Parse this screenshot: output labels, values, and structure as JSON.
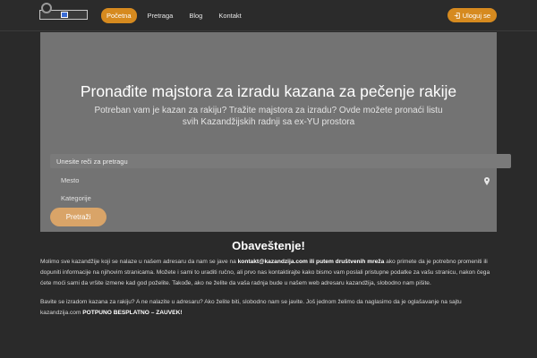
{
  "header": {
    "nav": [
      "Početna",
      "Pretraga",
      "Blog",
      "Kontakt"
    ],
    "active_index": 0,
    "login_label": "Uloguj se",
    "accent_color": "#d68a1f"
  },
  "hero": {
    "title": "Pronađite majstora za izradu kazana za pečenje rakije",
    "subtitle": "Potreban vam je kazan za rakiju? Tražite majstora za izradu? Ovde možete pronaći listu svih Kazandžijskih radnji sa ex-YU prostora",
    "search_placeholder": "Unesite reči za pretragu",
    "place_placeholder": "Mesto",
    "category_placeholder": "Kategorije",
    "search_button": "Pretraži"
  },
  "notice": {
    "title": "Obaveštenje!",
    "p1_a": "Molimo sve kazandžije koji se nalaze u našem adresaru da nam se jave na ",
    "p1_b": "kontakt@kazandzija.com ili putem društvenih mreža",
    "p1_c": " ako primete da je potrebno promeniti ili dopuniti informacije na njihovim stranicama. Možete i sami to uraditi ručno, ali prvo nas kontaktirajte kako bismo vam poslali pristupne podatke za vašu stranicu, nakon čega ćete moći sami da vršite izmene kad god poželite. Takođe, ako ne želite da vaša radnja bude u našem web adresaru kazandžija, slobodno nam pišite.",
    "p2_a": "Bavite se izradom kazana za rakiju? A ne nalazite u adresaru? Ako želite biti, slobodno nam se javite. Još jednom želimo da naglasimo da je oglašavanje na sajtu kazandzija.com ",
    "p2_b": "POTPUNO BESPLATNO – ZAUVEK!"
  }
}
